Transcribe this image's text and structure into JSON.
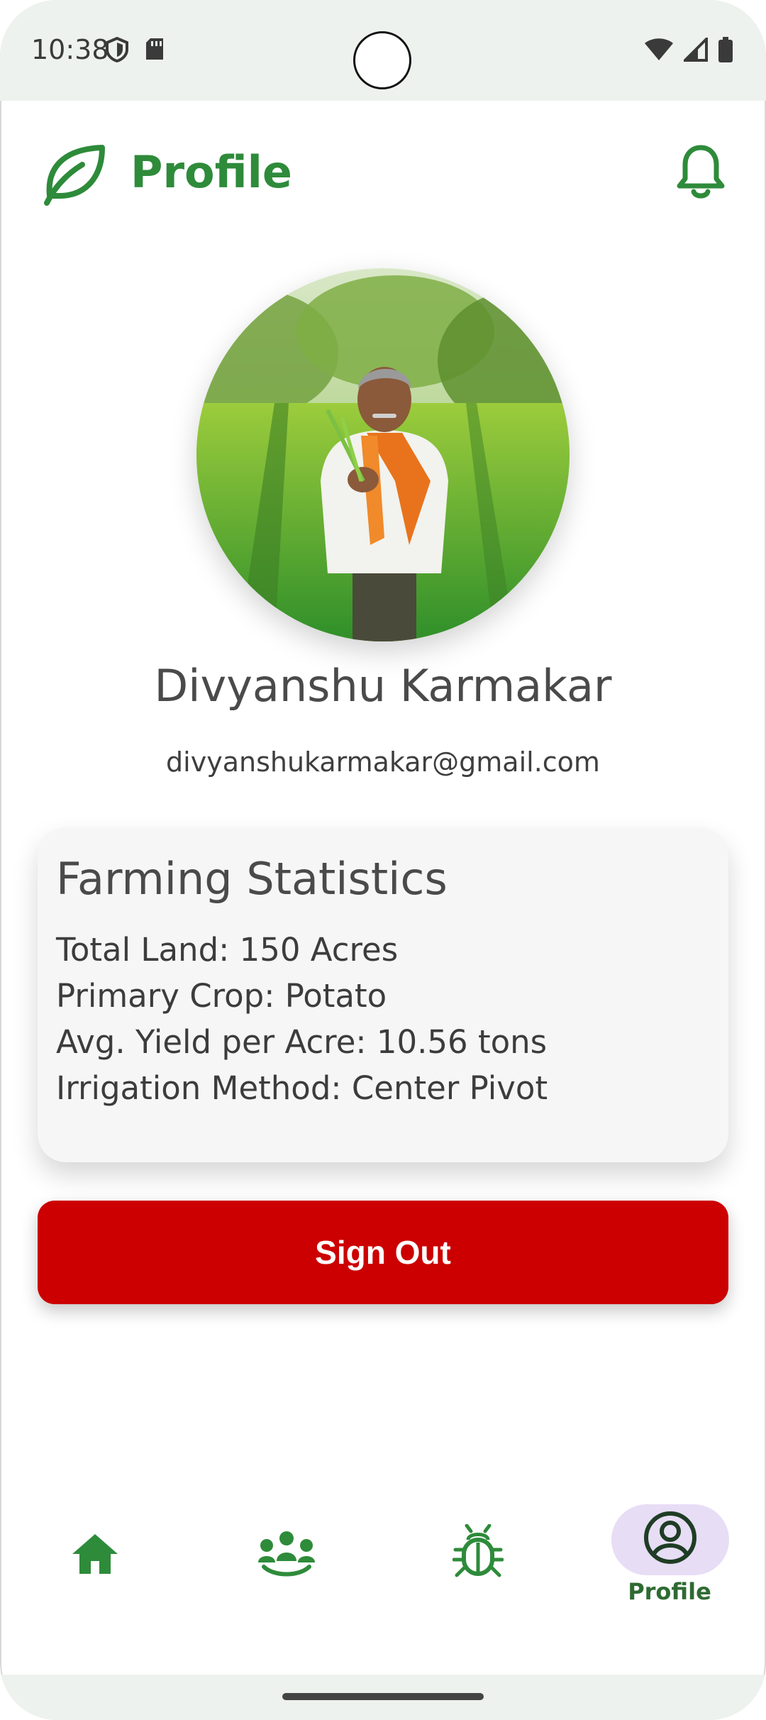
{
  "status_bar": {
    "time": "10:38",
    "left_icons": [
      "shield-icon",
      "sd-card-icon"
    ],
    "right_icons": [
      "wifi-icon",
      "signal-icon",
      "battery-icon"
    ]
  },
  "header": {
    "title": "Profile",
    "logo_icon": "leaf-icon",
    "notification_icon": "bell-icon"
  },
  "profile": {
    "name": "Divyanshu Karmakar",
    "email": "divyanshukarmakar@gmail.com"
  },
  "stats": {
    "title": "Farming Statistics",
    "lines": [
      "Total Land: 150 Acres",
      "Primary Crop: Potato",
      "Avg. Yield per Acre: 10.56 tons",
      "Irrigation Method: Center Pivot"
    ]
  },
  "actions": {
    "signout_label": "Sign Out"
  },
  "bottom_nav": {
    "items": [
      {
        "icon": "home-icon"
      },
      {
        "icon": "community-icon"
      },
      {
        "icon": "bug-icon"
      },
      {
        "icon": "profile-icon",
        "label": "Profile",
        "active": true
      }
    ]
  },
  "colors": {
    "brand_green": "#2e8b3a",
    "signout_red": "#cc0000",
    "active_pill": "#e7ddf5"
  }
}
